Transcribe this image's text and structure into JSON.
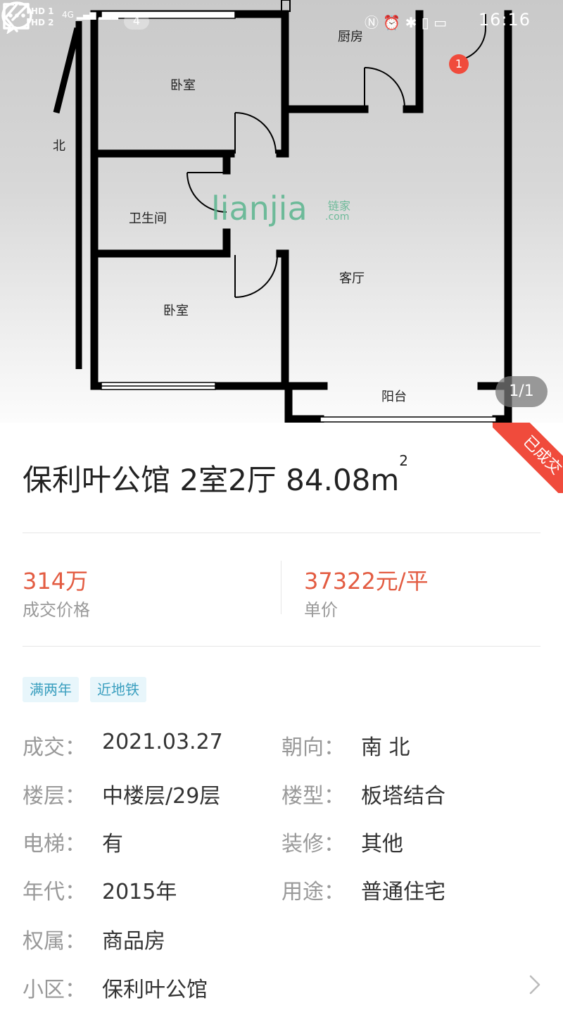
{
  "status_bar": {
    "sim_labels": [
      "HD 1",
      "HD 2"
    ],
    "network": "4G",
    "notification_count": "4",
    "time": "16:16"
  },
  "floorplan": {
    "rooms": {
      "kitchen": "厨房",
      "bedroom_top": "卧室",
      "bathroom": "卫生间",
      "living": "客厅",
      "bedroom_bottom": "卧室",
      "balcony": "阳台"
    },
    "compass": "北",
    "watermark": "lianjia",
    "watermark_sub_cn": "链家",
    "watermark_sub_en": ".com",
    "counter": "1/1"
  },
  "nav": {
    "chat_badge": "1"
  },
  "corner_ribbon": "已成交",
  "title": {
    "text": "保利叶公馆 2室2厅 84.08m",
    "unit_sup": "2"
  },
  "prices": [
    {
      "value": "314万",
      "label": "成交价格"
    },
    {
      "value": "37322元/平",
      "label": "单价"
    }
  ],
  "tags": [
    "满两年",
    "近地铁"
  ],
  "details": {
    "deal_date": {
      "label": "成交：",
      "value": "2021.03.27"
    },
    "orientation": {
      "label": "朝向：",
      "value": "南 北"
    },
    "floor": {
      "label": "楼层：",
      "value": "中楼层/29层"
    },
    "building_type": {
      "label": "楼型：",
      "value": "板塔结合"
    },
    "elevator": {
      "label": "电梯：",
      "value": "有"
    },
    "decoration": {
      "label": "装修：",
      "value": "其他"
    },
    "year": {
      "label": "年代：",
      "value": "2015年"
    },
    "usage": {
      "label": "用途：",
      "value": "普通住宅"
    },
    "ownership": {
      "label": "权属：",
      "value": "商品房"
    },
    "community": {
      "label": "小区：",
      "value": "保利叶公馆"
    }
  },
  "colors": {
    "accent_red": "#e35c42",
    "tag_blue": "#3a9fbf",
    "tag_bg": "#e8f6fb",
    "watermark_green": "#5ab58e",
    "badge_red": "#f04b3c"
  }
}
